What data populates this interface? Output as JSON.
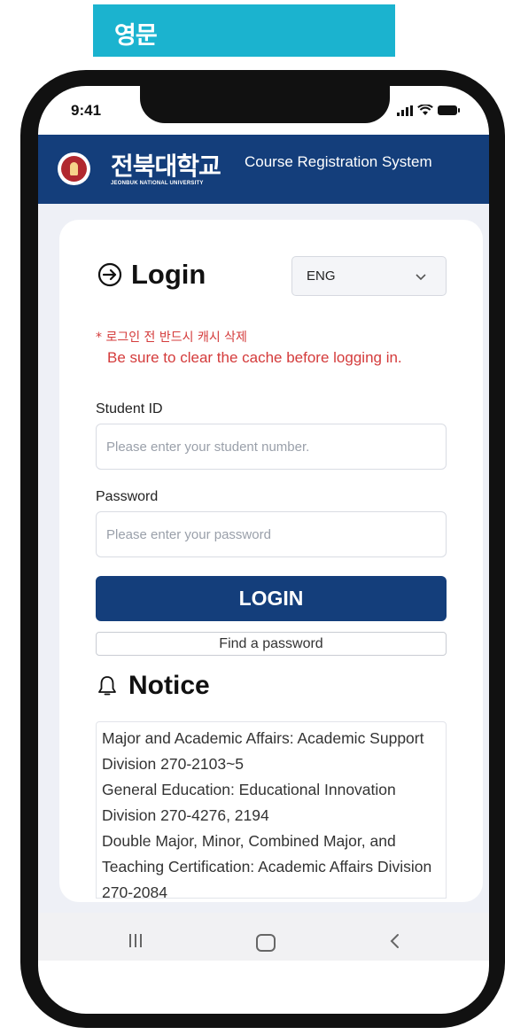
{
  "top_label": "영문",
  "status_bar": {
    "time": "9:41"
  },
  "header": {
    "university_name": "전북대학교",
    "university_name_en": "JEONBUK NATIONAL UNIVERSITY",
    "system_title": "Course Registration System"
  },
  "login": {
    "title": "Login",
    "language_selected": "ENG",
    "warning_ko": "* 로그인 전 반드시 캐시 삭제",
    "warning_en": "Be sure to clear the cache before logging in.",
    "student_id_label": "Student ID",
    "student_id_placeholder": "Please enter your student number.",
    "password_label": "Password",
    "password_placeholder": "Please enter your password",
    "login_button": "LOGIN",
    "find_password_button": "Find a password"
  },
  "notice": {
    "title": "Notice",
    "lines": [
      " Major and Academic Affairs: Academic Support Division 270-2103~5",
      " General Education: Educational Innovation Division 270-4276, 2194",
      " Double Major, Minor, Combined Major, and Teaching Certification: Academic Affairs Division 270-2084"
    ]
  },
  "colors": {
    "brand_navy": "#143e7b",
    "top_label_bg": "#1bb3cf",
    "warning_red": "#d43b3b"
  },
  "icons": {
    "login": "arrow-in-circle-icon",
    "language": "chevron-down-icon",
    "notice": "bell-icon",
    "nav_recent": "recent-apps-icon",
    "nav_home": "home-icon",
    "nav_back": "back-icon"
  }
}
